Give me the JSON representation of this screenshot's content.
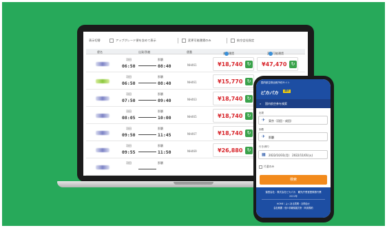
{
  "laptop": {
    "filters": [
      {
        "label": "表示切替"
      },
      {
        "label": "アップグレード便を含めて表示"
      },
      {
        "label": "変更可能運賃のみ"
      },
      {
        "label": "航空会社指定"
      }
    ],
    "columns": {
      "airline": "便名",
      "schedule": "出発/到着",
      "flight_no": "便番",
      "fare_a": "普通運賃",
      "fare_b": "変更可能運賃"
    },
    "rows": [
      {
        "dep_city": "羽田",
        "arr_city": "那覇",
        "dep": "06:50",
        "arr": "08:40",
        "flight": "NH461",
        "fare_a": "¥18,740",
        "fare_b": "¥47,470",
        "logo": "purple"
      },
      {
        "dep_city": "羽田",
        "arr_city": "那覇",
        "dep": "06:50",
        "arr": "08:40",
        "flight": "NH461",
        "fare_a": "¥15,770",
        "fare_b": "",
        "logo": "green"
      },
      {
        "dep_city": "羽田",
        "arr_city": "那覇",
        "dep": "07:50",
        "arr": "09:40",
        "flight": "NH463",
        "fare_a": "¥18,740",
        "fare_b": "",
        "logo": "purple"
      },
      {
        "dep_city": "羽田",
        "arr_city": "那覇",
        "dep": "08:05",
        "arr": "10:00",
        "flight": "NH465",
        "fare_a": "¥18,740",
        "fare_b": "",
        "logo": "purple"
      },
      {
        "dep_city": "羽田",
        "arr_city": "那覇",
        "dep": "09:50",
        "arr": "11:45",
        "flight": "NH467",
        "fare_a": "¥18,740",
        "fare_b": "",
        "logo": "purple"
      },
      {
        "dep_city": "羽田",
        "arr_city": "那覇",
        "dep": "09:55",
        "arr": "11:50",
        "flight": "NH469",
        "fare_a": "¥26,880",
        "fare_b": "",
        "logo": "purple"
      },
      {
        "dep_city": "羽田",
        "arr_city": "那覇",
        "dep": "",
        "arr": "",
        "flight": "",
        "fare_a": "",
        "fare_b": "",
        "logo": "purple"
      }
    ],
    "select_icon": "refresh-icon",
    "info_icon": "question-icon"
  },
  "phone": {
    "tagline": "国内航空券比較予約サイト",
    "logo": "ピカパカ",
    "logo_badge": "国内",
    "nav_label": "国内航空券を検索",
    "from_label": "出発",
    "from_value": "東京（羽田・成田）",
    "to_label": "到着",
    "to_value": "那覇",
    "date_label": "行き/帰り",
    "date_value": "2022/10/31(月)　2022/11/01(火)",
    "oneway_label": "片道のみ",
    "search_button": "検索",
    "footer_title": "運営会社：株式会社ピカパカ　観光庁長官登録旅行業",
    "footer_note": "2022年",
    "footer_links1": "HOME｜よくある質問・お問合せ",
    "footer_links2": "会社概要｜個人情報保護方針｜利用規約",
    "colors": {
      "brand": "#1d4ea3",
      "accent": "#f28a1c",
      "background": "#27a95a"
    }
  }
}
